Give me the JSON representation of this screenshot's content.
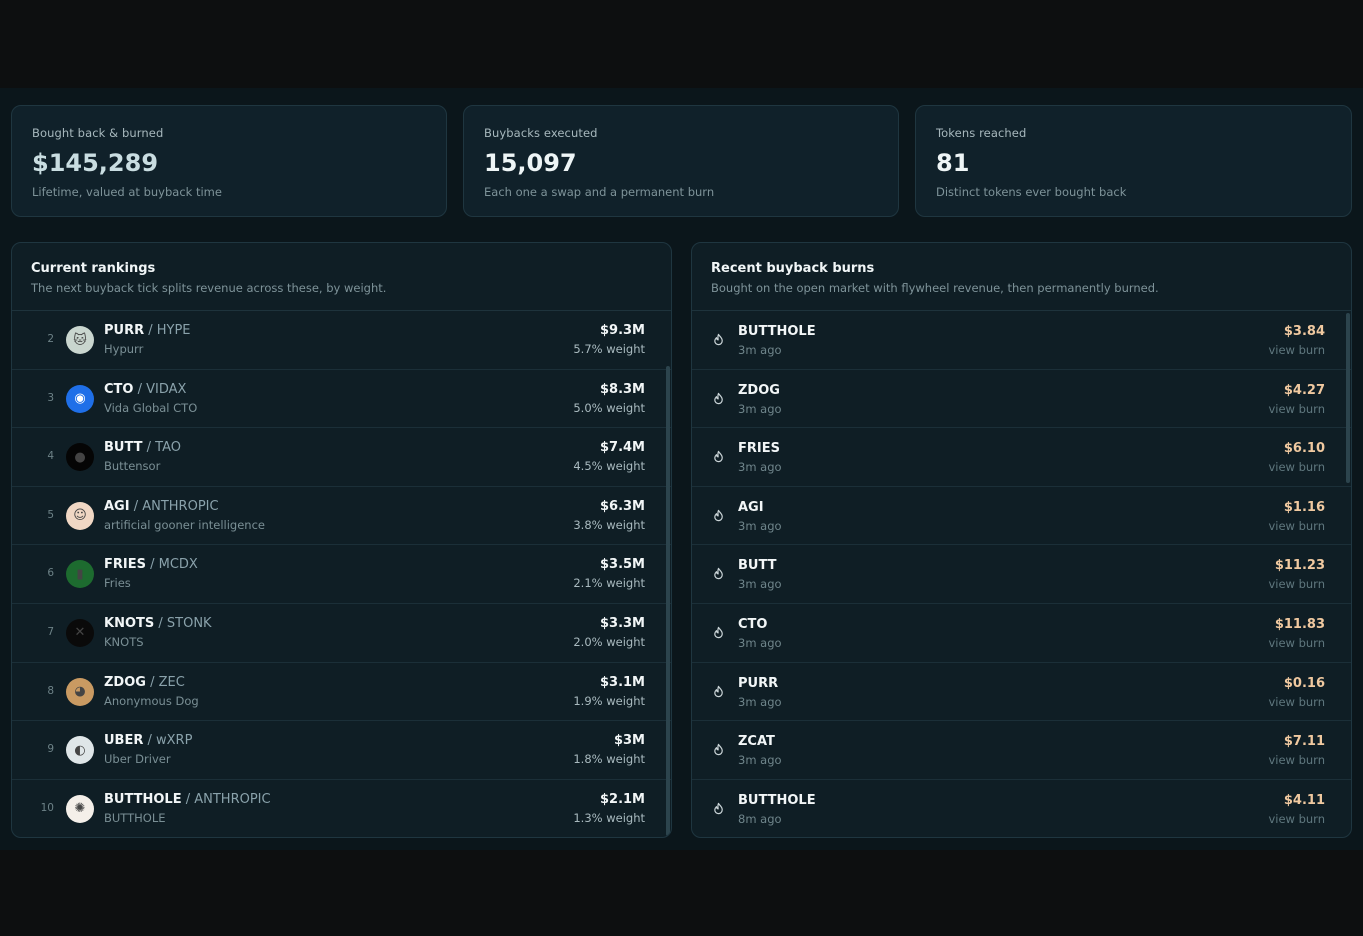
{
  "stats": [
    {
      "label": "Bought back & burned",
      "value": "$145,289",
      "sub": "Lifetime, valued at buyback time"
    },
    {
      "label": "Buybacks executed",
      "value": "15,097",
      "sub": "Each one a swap and a permanent burn"
    },
    {
      "label": "Tokens reached",
      "value": "81",
      "sub": "Distinct tokens ever bought back"
    }
  ],
  "rankings": {
    "title": "Current rankings",
    "subtitle": "The next buyback tick splits revenue across these, by weight.",
    "items": [
      {
        "rank": "2",
        "symbol": "PURR",
        "pair": " / HYPE",
        "name": "Hypurr",
        "value": "$9.3M",
        "weight": "5.7% weight",
        "avatar_icon": "cat-icon",
        "avatar_color": "#c9d6cf"
      },
      {
        "rank": "3",
        "symbol": "CTO",
        "pair": " / VIDAX",
        "name": "Vida Global CTO",
        "value": "$8.3M",
        "weight": "5.0% weight",
        "avatar_icon": "vida-logo-icon",
        "avatar_color": "#1f6fe8"
      },
      {
        "rank": "4",
        "symbol": "BUTT",
        "pair": " / TAO",
        "name": "Buttensor",
        "value": "$7.4M",
        "weight": "4.5% weight",
        "avatar_icon": "buttensor-logo-icon",
        "avatar_color": "#050505"
      },
      {
        "rank": "5",
        "symbol": "AGI",
        "pair": " / ANTHROPIC",
        "name": "artificial gooner intelligence",
        "value": "$6.3M",
        "weight": "3.8% weight",
        "avatar_icon": "anime-avatar-icon",
        "avatar_color": "#f0d7c4"
      },
      {
        "rank": "6",
        "symbol": "FRIES",
        "pair": " / MCDX",
        "name": "Fries",
        "value": "$3.5M",
        "weight": "2.1% weight",
        "avatar_icon": "fries-icon",
        "avatar_color": "#1d6b2f"
      },
      {
        "rank": "7",
        "symbol": "KNOTS",
        "pair": " / STONK",
        "name": "KNOTS",
        "value": "$3.3M",
        "weight": "2.0% weight",
        "avatar_icon": "knot-icon",
        "avatar_color": "#0a0a0a"
      },
      {
        "rank": "8",
        "symbol": "ZDOG",
        "pair": " / ZEC",
        "name": "Anonymous Dog",
        "value": "$3.1M",
        "weight": "1.9% weight",
        "avatar_icon": "dog-icon",
        "avatar_color": "#c99a62"
      },
      {
        "rank": "9",
        "symbol": "UBER",
        "pair": " / wXRP",
        "name": "Uber Driver",
        "value": "$3M",
        "weight": "1.8% weight",
        "avatar_icon": "driver-icon",
        "avatar_color": "#dfe6e8"
      },
      {
        "rank": "10",
        "symbol": "BUTTHOLE",
        "pair": " / ANTHROPIC",
        "name": "BUTTHOLE",
        "value": "$2.1M",
        "weight": "1.3% weight",
        "avatar_icon": "starburst-icon",
        "avatar_color": "#f4efe9"
      }
    ]
  },
  "burns": {
    "title": "Recent buyback burns",
    "subtitle": "Bought on the open market with flywheel revenue, then permanently burned.",
    "link_label": "view burn",
    "items": [
      {
        "token": "BUTTHOLE",
        "time": "3m ago",
        "amount": "$3.84"
      },
      {
        "token": "ZDOG",
        "time": "3m ago",
        "amount": "$4.27"
      },
      {
        "token": "FRIES",
        "time": "3m ago",
        "amount": "$6.10"
      },
      {
        "token": "AGI",
        "time": "3m ago",
        "amount": "$1.16"
      },
      {
        "token": "BUTT",
        "time": "3m ago",
        "amount": "$11.23"
      },
      {
        "token": "CTO",
        "time": "3m ago",
        "amount": "$11.83"
      },
      {
        "token": "PURR",
        "time": "3m ago",
        "amount": "$0.16"
      },
      {
        "token": "ZCAT",
        "time": "3m ago",
        "amount": "$7.11"
      },
      {
        "token": "BUTTHOLE",
        "time": "8m ago",
        "amount": "$4.11"
      }
    ]
  },
  "colors": {
    "background": "#0d0f10",
    "card": "#10212a",
    "burn_amount": "#f0c9a0"
  }
}
